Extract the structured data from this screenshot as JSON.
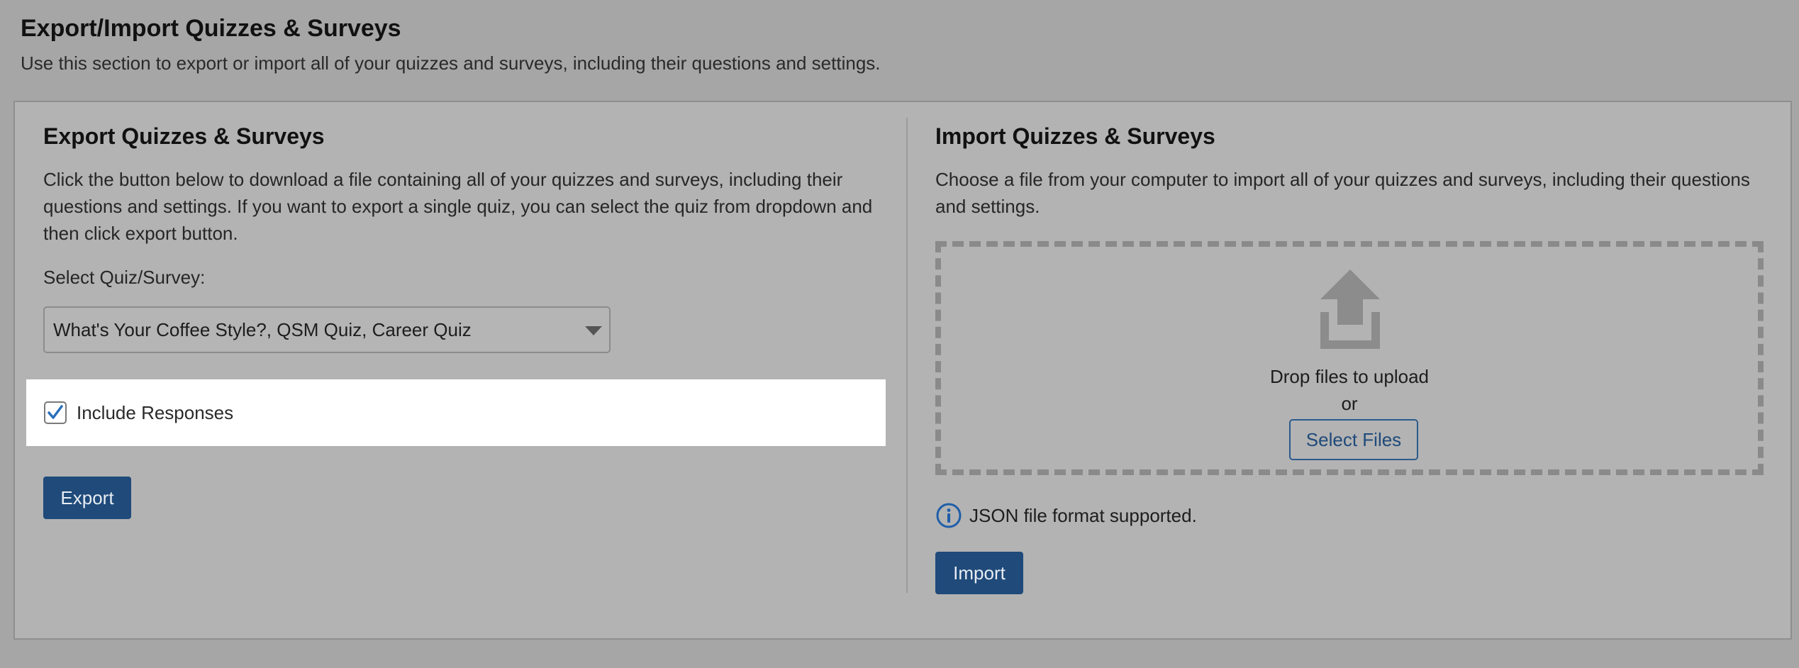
{
  "page": {
    "title": "Export/Import Quizzes & Surveys",
    "description": "Use this section to export or import all of your quizzes and surveys, including their questions and settings."
  },
  "export": {
    "title": "Export Quizzes & Surveys",
    "description": "Click the button below to download a file containing all of your quizzes and surveys, including their questions and settings. If you want to export a single quiz, you can select the quiz from dropdown and then click export button.",
    "select_label": "Select Quiz/Survey:",
    "select_value": "What's Your Coffee Style?, QSM Quiz, Career Quiz",
    "include_responses_label": "Include Responses",
    "include_responses_checked": true,
    "button_label": "Export"
  },
  "import": {
    "title": "Import Quizzes & Surveys",
    "description": "Choose a file from your computer to import all of your quizzes and surveys, including their questions and settings.",
    "drop_text": "Drop files to upload",
    "or_text": "or",
    "select_files_label": "Select Files",
    "format_note": "JSON file format supported.",
    "button_label": "Import"
  },
  "colors": {
    "primary": "#1f4a7a",
    "checkmark": "#2a6fbb",
    "info_icon": "#1f5ea8",
    "upload_icon": "#8c8c8c"
  },
  "icons": {
    "upload": "upload-icon",
    "info": "info-icon",
    "dropdown": "chevron-down-icon",
    "check": "check-icon"
  }
}
